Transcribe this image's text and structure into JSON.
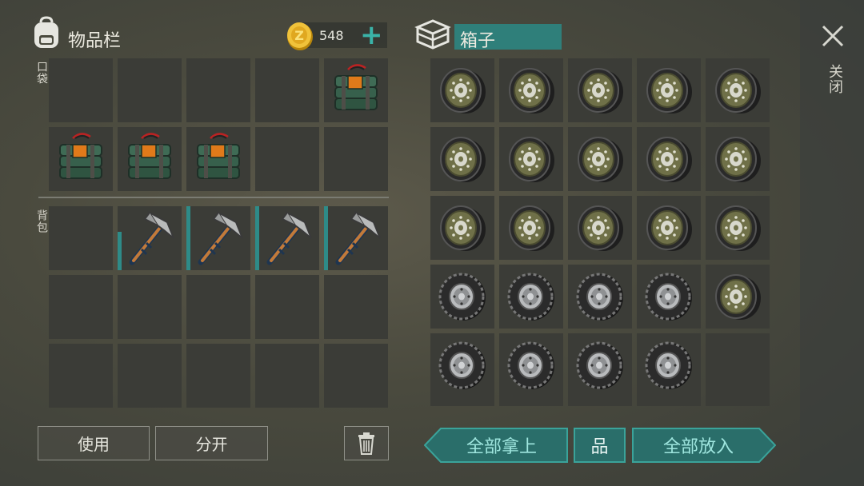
{
  "inventory": {
    "title": "物品栏",
    "pocket_label": "口袋",
    "backpack_label": "背包"
  },
  "currency": {
    "amount": "548",
    "add_symbol": "+"
  },
  "container": {
    "title": "箱子"
  },
  "close": {
    "label": "关闭"
  },
  "actions": {
    "use_label": "使用",
    "split_label": "分开",
    "take_all_label": "全部拿上",
    "sort_symbol": "品",
    "put_all_label": "全部放入"
  },
  "pocket_slots": [
    {
      "item": "empty"
    },
    {
      "item": "empty"
    },
    {
      "item": "empty"
    },
    {
      "item": "empty"
    },
    {
      "item": "c4-explosive"
    },
    {
      "item": "c4-explosive"
    },
    {
      "item": "c4-explosive"
    },
    {
      "item": "c4-explosive"
    },
    {
      "item": "empty"
    },
    {
      "item": "empty"
    }
  ],
  "backpack_slots": [
    {
      "item": "empty"
    },
    {
      "item": "pickaxe",
      "durability": 0.6
    },
    {
      "item": "pickaxe",
      "durability": 1.0
    },
    {
      "item": "pickaxe",
      "durability": 1.0
    },
    {
      "item": "pickaxe",
      "durability": 1.0
    },
    {
      "item": "empty"
    },
    {
      "item": "empty"
    },
    {
      "item": "empty"
    },
    {
      "item": "empty"
    },
    {
      "item": "empty"
    },
    {
      "item": "empty"
    },
    {
      "item": "empty"
    },
    {
      "item": "empty"
    },
    {
      "item": "empty"
    },
    {
      "item": "empty"
    }
  ],
  "box_slots": [
    {
      "item": "wheel-rim"
    },
    {
      "item": "wheel-rim"
    },
    {
      "item": "wheel-rim"
    },
    {
      "item": "wheel-rim"
    },
    {
      "item": "wheel-rim"
    },
    {
      "item": "wheel-rim"
    },
    {
      "item": "wheel-rim"
    },
    {
      "item": "wheel-rim"
    },
    {
      "item": "wheel-rim"
    },
    {
      "item": "wheel-rim"
    },
    {
      "item": "wheel-rim"
    },
    {
      "item": "wheel-rim"
    },
    {
      "item": "wheel-rim"
    },
    {
      "item": "wheel-rim"
    },
    {
      "item": "wheel-rim"
    },
    {
      "item": "tire"
    },
    {
      "item": "tire"
    },
    {
      "item": "tire"
    },
    {
      "item": "tire"
    },
    {
      "item": "wheel-rim"
    },
    {
      "item": "tire"
    },
    {
      "item": "tire"
    },
    {
      "item": "tire"
    },
    {
      "item": "tire"
    },
    {
      "item": "empty"
    }
  ],
  "colors": {
    "accent_teal": "#2f7f7a",
    "teal_text": "#9fe6df",
    "slot_bg": "#3b3c37",
    "durability_bar": "#2e8b88"
  }
}
